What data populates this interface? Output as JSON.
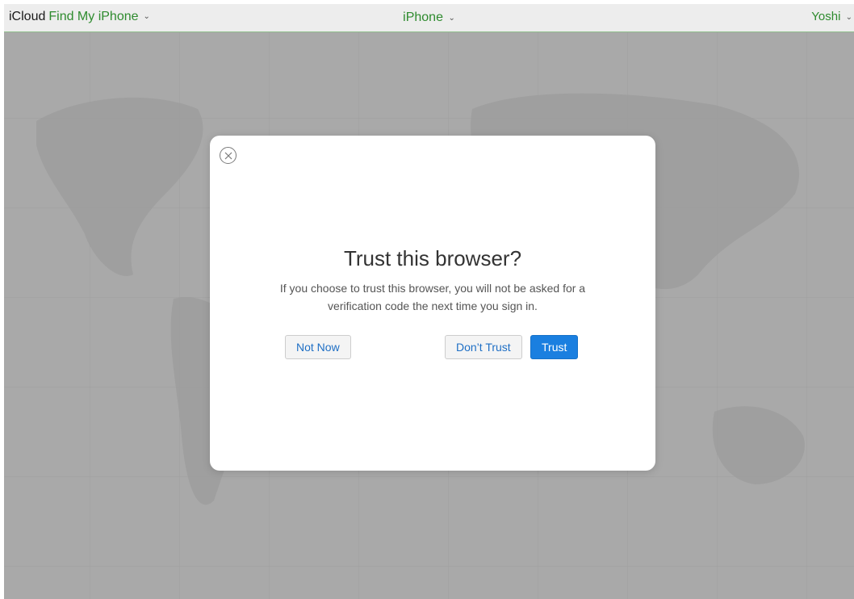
{
  "topbar": {
    "brand": "iCloud",
    "app_name": "Find My iPhone",
    "device": "iPhone",
    "user": "Yoshi",
    "chevron": "⌄"
  },
  "dialog": {
    "title": "Trust this browser?",
    "description": "If you choose to trust this browser, you will not be asked for a verification code the next time you sign in.",
    "not_now_label": "Not Now",
    "dont_trust_label": "Don’t Trust",
    "trust_label": "Trust",
    "close_icon": "close-circle-icon"
  },
  "colors": {
    "accent_green": "#2e8b2e",
    "primary_blue": "#1a7fe0",
    "map_gray": "#a9a9a9"
  }
}
